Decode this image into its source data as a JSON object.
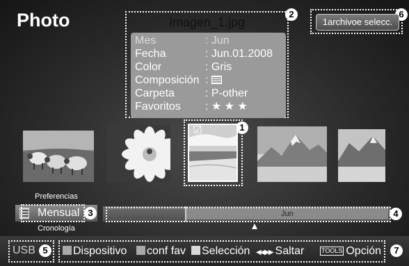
{
  "header": {
    "title": "Photo"
  },
  "info": {
    "filename": "Imagen_1.jpg",
    "rows": [
      {
        "key": "Mes",
        "value": ": Jun"
      },
      {
        "key": "Fecha",
        "value": ": Jun.01.2008"
      },
      {
        "key": "Color",
        "value": ": Gris"
      },
      {
        "key": "Composición",
        "value": ": "
      },
      {
        "key": "Carpeta",
        "value": ": P-other"
      },
      {
        "key": "Favoritos",
        "value": ": ★ ★ ★"
      }
    ]
  },
  "selected_count_button": "1archivoe selecc.",
  "thumbnails": [
    {
      "name": "sheep",
      "selected": false
    },
    {
      "name": "flower",
      "selected": false
    },
    {
      "name": "beach",
      "selected": true,
      "check": "☑"
    },
    {
      "name": "mountains",
      "selected": false
    },
    {
      "name": "mountains-2",
      "selected": false
    }
  ],
  "view_menu": {
    "above": "Preferencias",
    "current": "Mensual",
    "below": "Cronología"
  },
  "timeline": {
    "label": "Jun"
  },
  "bottom": {
    "device": "USB",
    "items": [
      {
        "label": "Dispositivo",
        "color": "#b0b0b0"
      },
      {
        "label": "conf fav",
        "color": "#b0b0b0"
      },
      {
        "label": "Selección",
        "color": "#b0b0b0"
      }
    ],
    "saltar": "Saltar",
    "arrows": "◀◀ ▶▶",
    "tools": "TOOLS",
    "opcion": "Opción"
  },
  "callouts": [
    "1",
    "2",
    "3",
    "4",
    "5",
    "6",
    "7"
  ]
}
